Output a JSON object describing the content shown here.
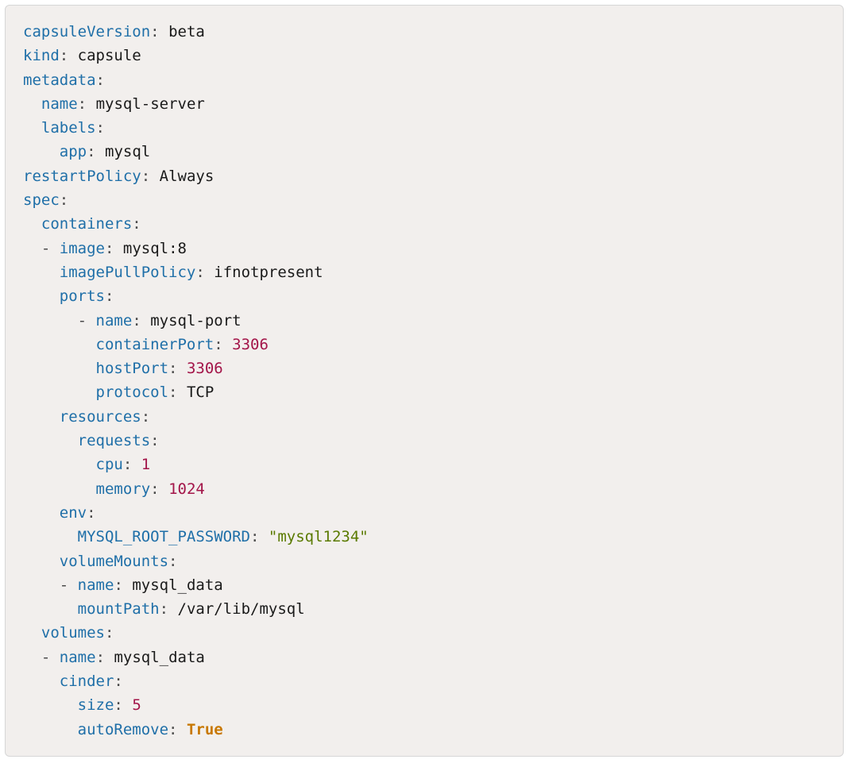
{
  "yaml": {
    "capsuleVersion": {
      "key": "capsuleVersion",
      "value": "beta"
    },
    "kind": {
      "key": "kind",
      "value": "capsule"
    },
    "metadata": {
      "key": "metadata",
      "name": {
        "key": "name",
        "value": "mysql-server"
      },
      "labels": {
        "key": "labels",
        "app": {
          "key": "app",
          "value": "mysql"
        }
      }
    },
    "restartPolicy": {
      "key": "restartPolicy",
      "value": "Always"
    },
    "spec": {
      "key": "spec",
      "containers": {
        "key": "containers",
        "item0": {
          "image": {
            "key": "image",
            "value": "mysql:8"
          },
          "imagePullPolicy": {
            "key": "imagePullPolicy",
            "value": "ifnotpresent"
          },
          "ports": {
            "key": "ports",
            "item0": {
              "name": {
                "key": "name",
                "value": "mysql-port"
              },
              "containerPort": {
                "key": "containerPort",
                "value": "3306"
              },
              "hostPort": {
                "key": "hostPort",
                "value": "3306"
              },
              "protocol": {
                "key": "protocol",
                "value": "TCP"
              }
            }
          },
          "resources": {
            "key": "resources",
            "requests": {
              "key": "requests",
              "cpu": {
                "key": "cpu",
                "value": "1"
              },
              "memory": {
                "key": "memory",
                "value": "1024"
              }
            }
          },
          "env": {
            "key": "env",
            "mysqlRootPassword": {
              "key": "MYSQL_ROOT_PASSWORD",
              "value": "\"mysql1234\""
            }
          },
          "volumeMounts": {
            "key": "volumeMounts",
            "item0": {
              "name": {
                "key": "name",
                "value": "mysql_data"
              },
              "mountPath": {
                "key": "mountPath",
                "value": "/var/lib/mysql"
              }
            }
          }
        }
      },
      "volumes": {
        "key": "volumes",
        "item0": {
          "name": {
            "key": "name",
            "value": "mysql_data"
          },
          "cinder": {
            "key": "cinder",
            "size": {
              "key": "size",
              "value": "5"
            },
            "autoRemove": {
              "key": "autoRemove",
              "value": "True"
            }
          }
        }
      }
    }
  }
}
